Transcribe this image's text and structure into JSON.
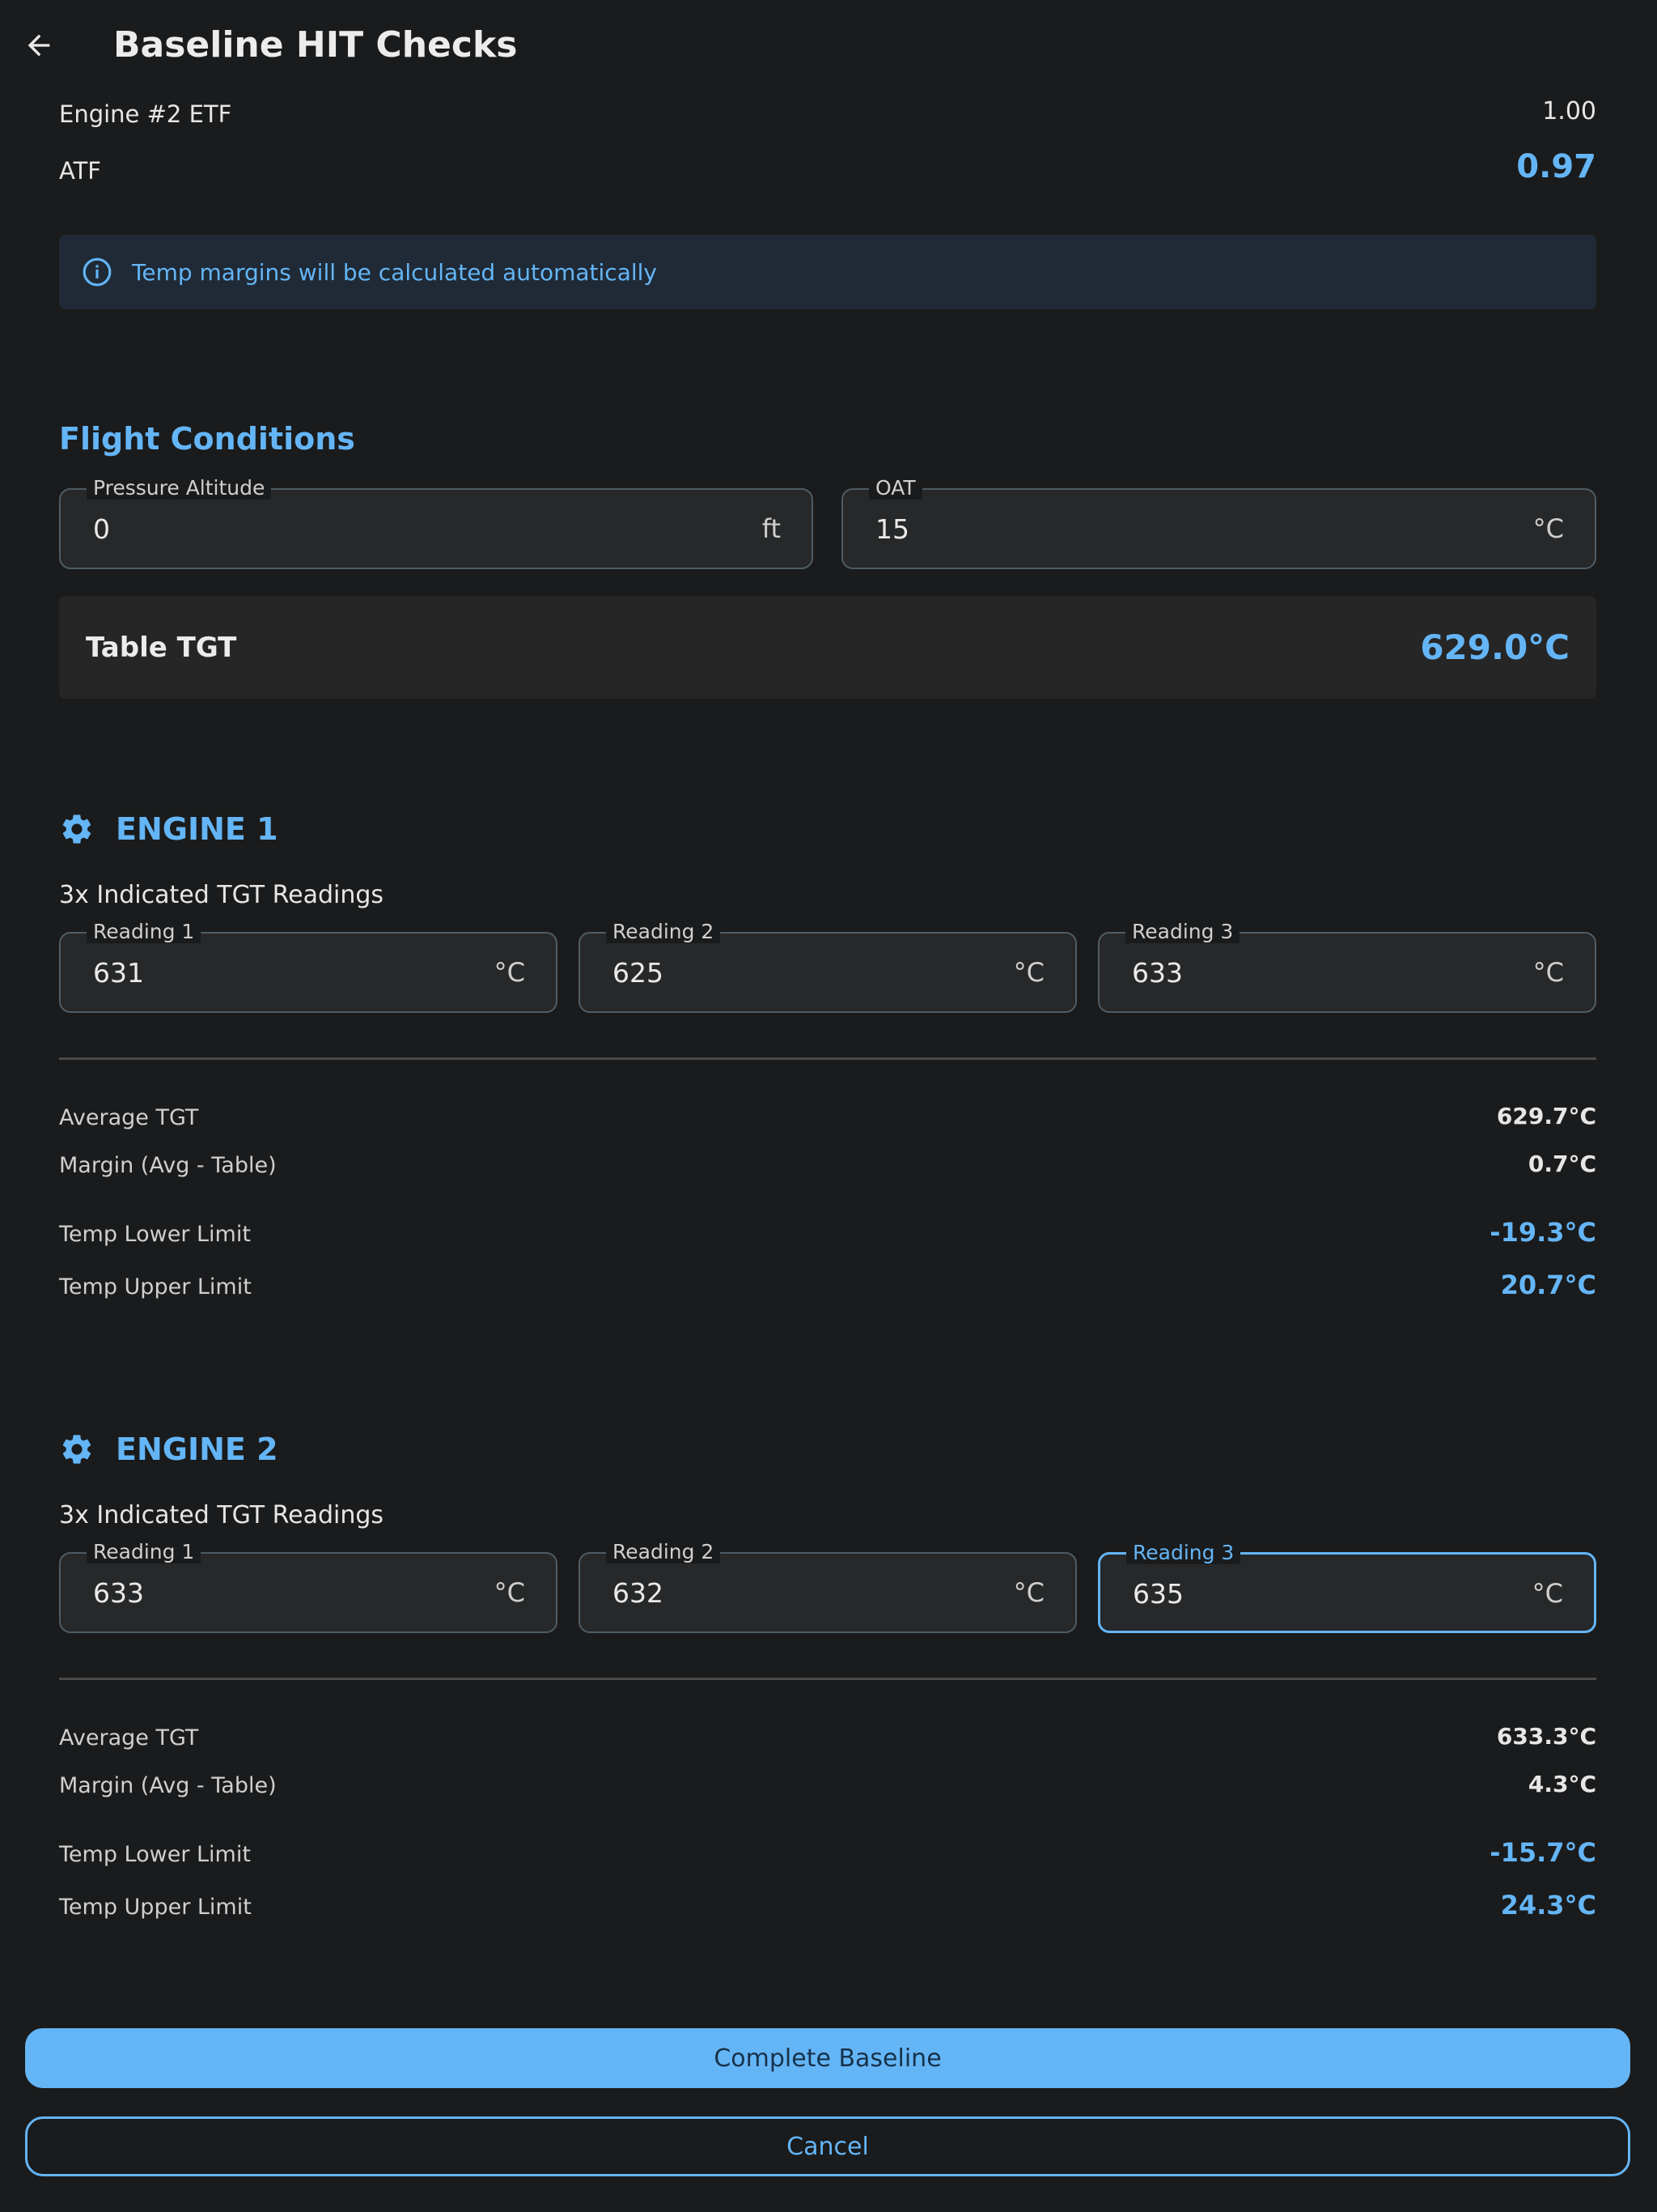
{
  "header": {
    "title": "Baseline HIT Checks",
    "back_icon": "arrow-left-icon"
  },
  "factors": [
    {
      "label": "Engine #2 ETF",
      "value": "1.00"
    },
    {
      "label": "ATF",
      "value": "0.97"
    }
  ],
  "info": {
    "icon": "info-circle-icon",
    "text": "Temp margins will be calculated automatically"
  },
  "flight_conditions": {
    "title": "Flight Conditions",
    "pressure_altitude": {
      "label": "Pressure Altitude",
      "value": "0",
      "unit": "ft"
    },
    "oat": {
      "label": "OAT",
      "value": "15",
      "unit": "°C"
    },
    "table_tgt": {
      "label": "Table TGT",
      "value": "629.0°C"
    }
  },
  "engines": [
    {
      "title": "ENGINE 1",
      "icon": "gear-icon",
      "readings_label": "3x Indicated TGT Readings",
      "readings": [
        {
          "label": "Reading 1",
          "value": "631",
          "unit": "°C"
        },
        {
          "label": "Reading 2",
          "value": "625",
          "unit": "°C"
        },
        {
          "label": "Reading 3",
          "value": "633",
          "unit": "°C"
        }
      ],
      "stats": {
        "average_label": "Average TGT",
        "average": "629.7°C",
        "margin_label": "Margin (Avg - Table)",
        "margin": "0.7°C",
        "lower_label": "Temp Lower Limit",
        "lower": "-19.3°C",
        "upper_label": "Temp Upper Limit",
        "upper": "20.7°C"
      }
    },
    {
      "title": "ENGINE 2",
      "icon": "gear-icon",
      "readings_label": "3x Indicated TGT Readings",
      "readings": [
        {
          "label": "Reading 1",
          "value": "633",
          "unit": "°C"
        },
        {
          "label": "Reading 2",
          "value": "632",
          "unit": "°C"
        },
        {
          "label": "Reading 3",
          "value": "635",
          "unit": "°C"
        }
      ],
      "stats": {
        "average_label": "Average TGT",
        "average": "633.3°C",
        "margin_label": "Margin (Avg - Table)",
        "margin": "4.3°C",
        "lower_label": "Temp Lower Limit",
        "lower": "-15.7°C",
        "upper_label": "Temp Upper Limit",
        "upper": "24.3°C"
      }
    }
  ],
  "actions": {
    "complete": "Complete Baseline",
    "cancel": "Cancel"
  },
  "colors": {
    "background": "#1a1b1c",
    "accent": "#64b5f6",
    "field_border": "#4d5d66"
  }
}
